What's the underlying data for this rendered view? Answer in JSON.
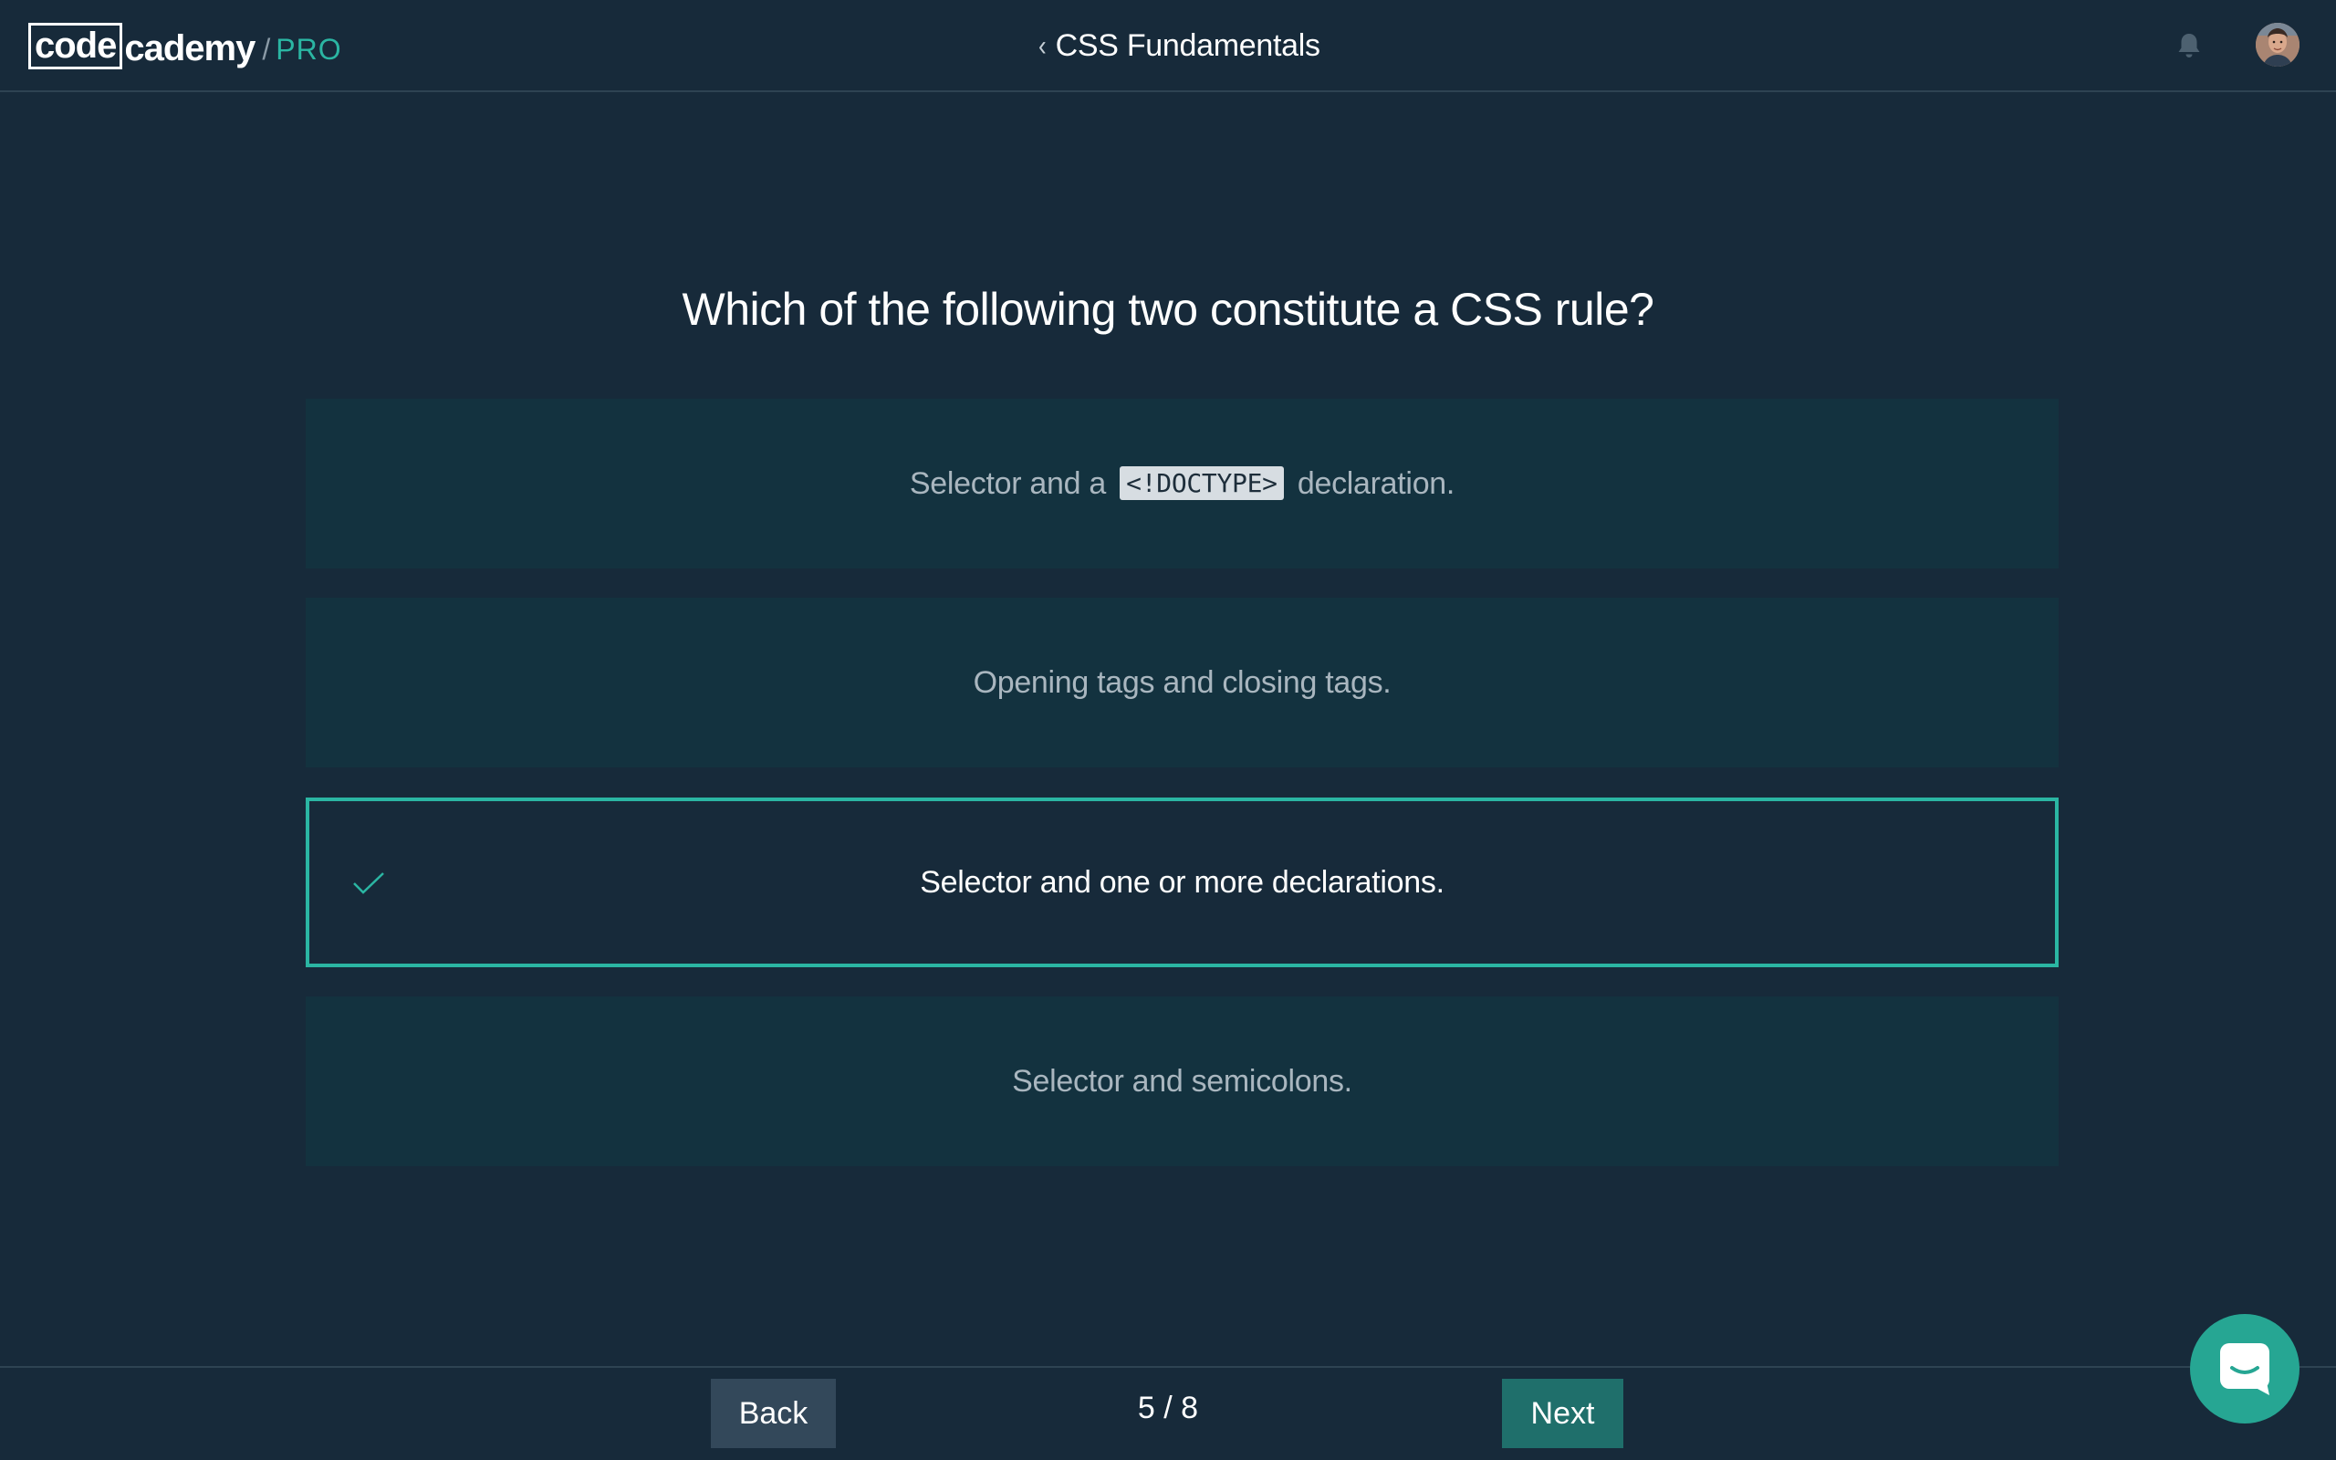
{
  "header": {
    "logo": {
      "code": "code",
      "cademy": "cademy",
      "slash": "/",
      "pro": "PRO"
    },
    "course_title": "CSS Fundamentals",
    "back_chevron": "‹",
    "icons": [
      "bell-icon",
      "avatar"
    ]
  },
  "quiz": {
    "question": "Which of the following two constitute a CSS rule?",
    "options": [
      {
        "prefix": "Selector and a",
        "code": "<!DOCTYPE>",
        "suffix": "declaration.",
        "selected": false
      },
      {
        "text": "Opening tags and closing tags.",
        "selected": false
      },
      {
        "text": "Selector and one or more declarations.",
        "selected": true
      },
      {
        "text": "Selector and semicolons.",
        "selected": false
      }
    ]
  },
  "footer": {
    "back_label": "Back",
    "progress": "5 / 8",
    "next_label": "Next"
  },
  "colors": {
    "background": "#172a3a",
    "option_bg": "#13323f",
    "accent": "#2bb6a3",
    "next_button": "#1f6f6b",
    "back_button": "#33485a"
  }
}
